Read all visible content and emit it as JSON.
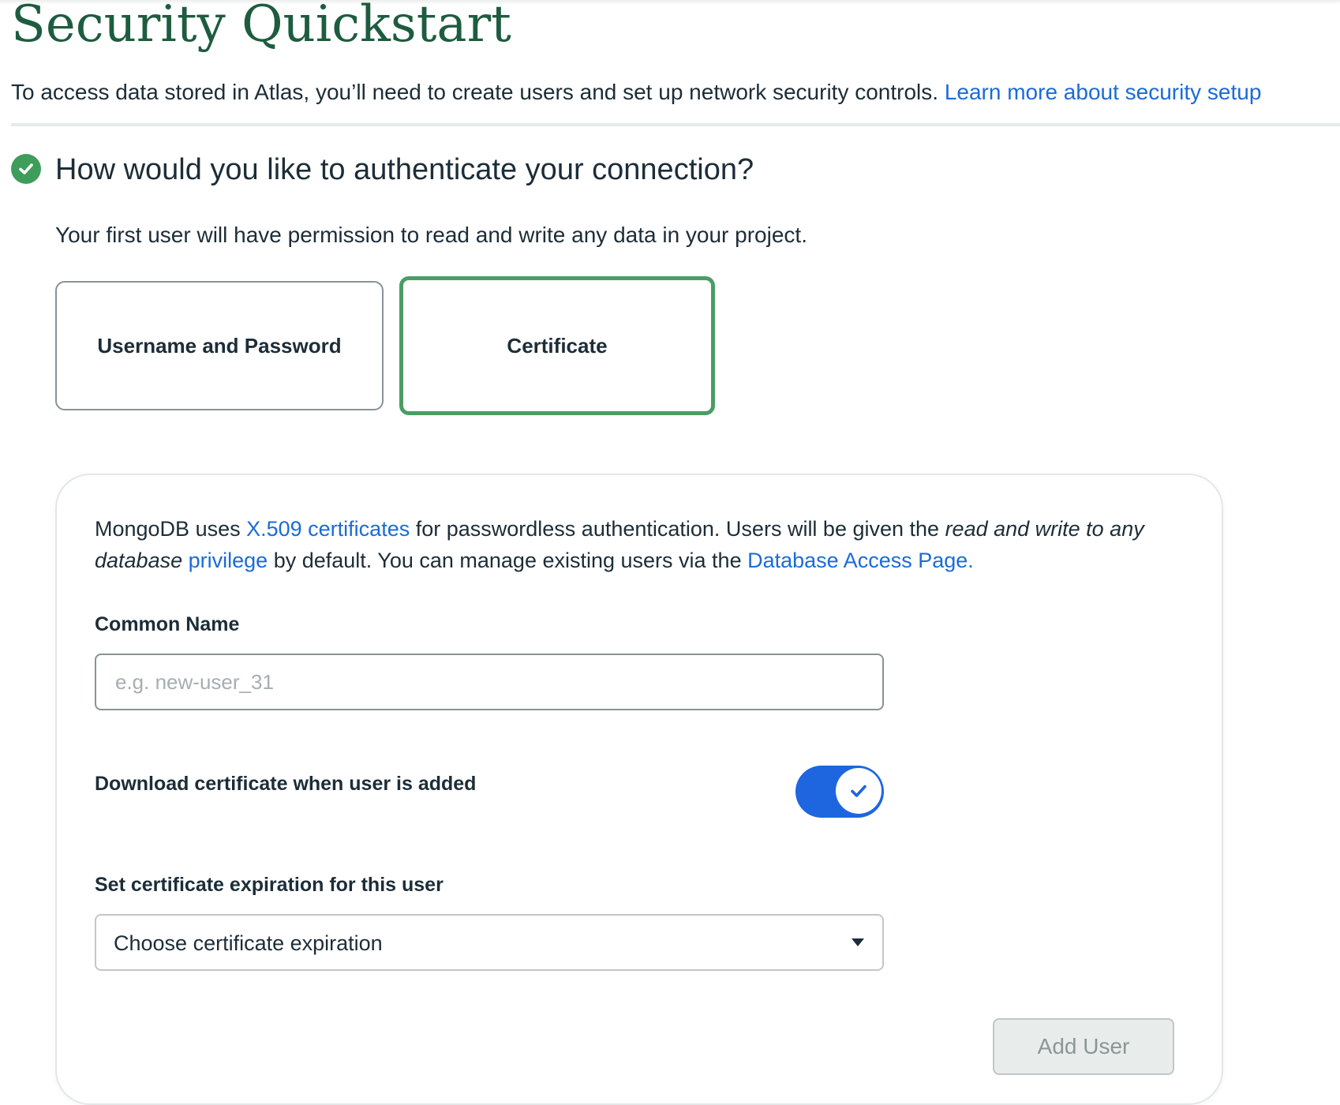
{
  "page": {
    "title": "Security Quickstart",
    "intro_text": "To access data stored in Atlas, you’ll need to create users and set up network security controls.",
    "intro_link": "Learn more about security setup"
  },
  "auth_section": {
    "title": "How would you like to authenticate your connection?",
    "description": "Your first user will have permission to read and write any data in your project.",
    "options": [
      {
        "label": "Username and Password",
        "selected": false
      },
      {
        "label": "Certificate",
        "selected": true
      }
    ]
  },
  "certificate_panel": {
    "description_parts": {
      "t1": "MongoDB uses ",
      "link1": "X.509 certificates",
      "t2": " for passwordless authentication. Users will be given the ",
      "italic1": "read and write to any database",
      "t3": " ",
      "link2": "privilege",
      "t4": " by default. You can manage existing users via the ",
      "link3": "Database Access Page."
    },
    "common_name_label": "Common Name",
    "common_name_value": "",
    "common_name_placeholder": "e.g. new-user_31",
    "download_label": "Download certificate when user is added",
    "download_enabled": true,
    "expiration_label": "Set certificate expiration for this user",
    "expiration_selected": "Choose certificate expiration",
    "add_user_label": "Add User",
    "add_user_enabled": false
  },
  "colors": {
    "title_green": "#1e5c3f",
    "selected_border": "#4a9d64",
    "check_green": "#3e9d5b",
    "link_blue": "#1a6bd8",
    "toggle_blue": "#1e66e0",
    "disabled_button_bg": "#e8edeb"
  },
  "icons": {
    "section_status": "check-circle-icon",
    "toggle_state": "check-icon",
    "select_caret": "caret-down-icon"
  }
}
